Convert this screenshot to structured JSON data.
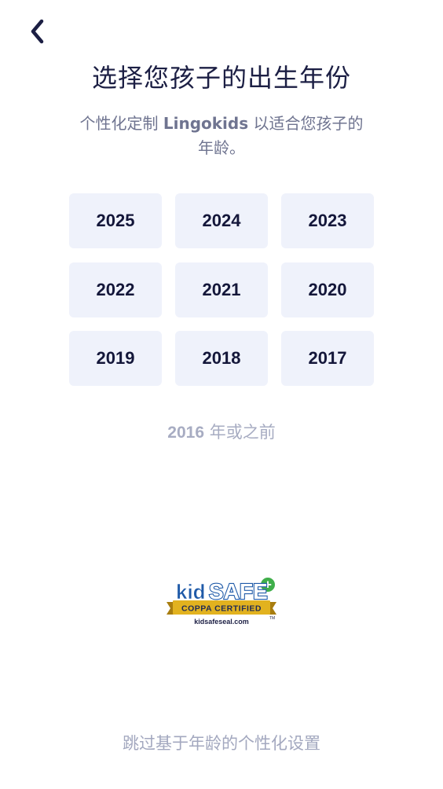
{
  "header": {
    "back_icon": "chevron-left-icon",
    "title": "选择您孩子的出生年份",
    "subtitle_prefix": "个性化定制 ",
    "subtitle_brand": "Lingokids",
    "subtitle_suffix": " 以适合您孩子的年龄。"
  },
  "years": [
    "2025",
    "2024",
    "2023",
    "2022",
    "2021",
    "2020",
    "2019",
    "2018",
    "2017"
  ],
  "older_option": {
    "year": "2016",
    "suffix": " 年或之前"
  },
  "seal": {
    "brand_kid": "kid",
    "brand_safe": "SAFE",
    "plus": "+",
    "ribbon_text": "COPPA CERTIFIED",
    "url": "kidsafeseal.com",
    "tm": "TM"
  },
  "footer": {
    "skip_label": "跳过基于年龄的个性化设置"
  },
  "colors": {
    "title": "#1c1f44",
    "subtitle": "#6f7490",
    "tile_bg": "#eff2fb",
    "tile_text": "#14173a",
    "muted": "#a7acc2",
    "seal_blue": "#1f5aa8",
    "seal_green": "#3fae4a",
    "seal_gold": "#e2b21f"
  }
}
